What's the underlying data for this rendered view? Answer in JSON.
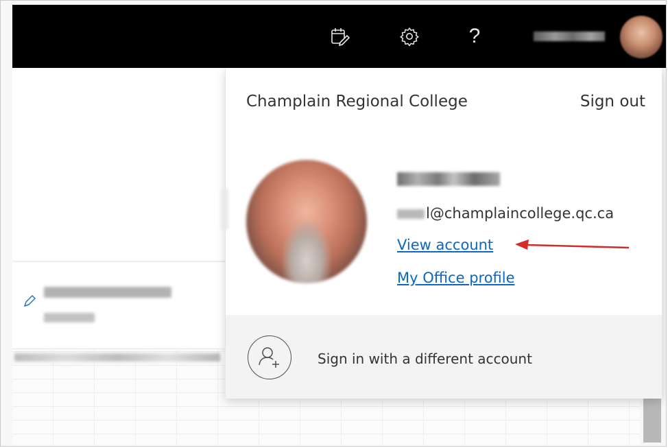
{
  "colors": {
    "topbar_bg": "#000000",
    "link": "#0a67c4",
    "arrow": "#d42a2a",
    "panel_bg": "#ffffff",
    "switch_bg": "#f3f3f3"
  },
  "topbar": {
    "icons": [
      "calendar-check-icon",
      "gear-icon",
      "help-icon",
      "avatar"
    ],
    "help_glyph": "?"
  },
  "account_panel": {
    "organization": "Champlain Regional College",
    "sign_out_label": "Sign out",
    "email_suffix": "l@champlaincollege.qc.ca",
    "view_account_label": "View account",
    "office_profile_label": "My Office profile",
    "switch_account_label": "Sign in with a different account"
  }
}
